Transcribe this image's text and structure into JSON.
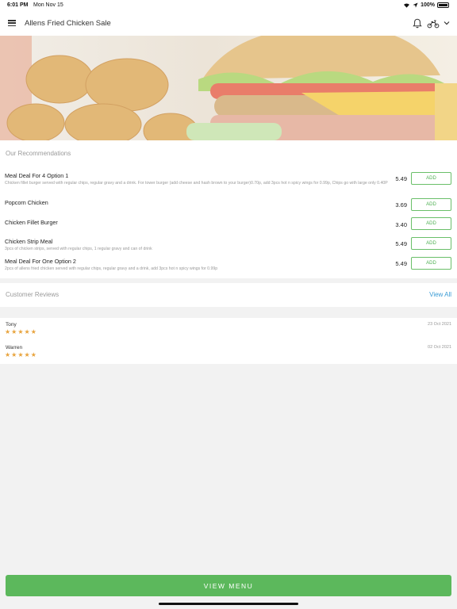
{
  "status": {
    "time": "6:01 PM",
    "date": "Mon Nov 15",
    "battery": "100%"
  },
  "header": {
    "title": "Allens Fried Chicken Sale"
  },
  "recommendations": {
    "title": "Our Recommendations",
    "add_label": "ADD",
    "items": [
      {
        "name": "Meal Deal For 4 Option 1",
        "desc": "Chicken fillet burger served with regular chips, regular gravy and a drink. For tower burger (add cheese and hash brown to your burger)0.70p, add 3pcs hot n spicy wings for 0.99p, Chips go with large only 0.40P",
        "price": "5.49"
      },
      {
        "name": "Popcorn Chicken",
        "desc": "",
        "price": "3.69"
      },
      {
        "name": "Chicken Fillet Burger",
        "desc": "",
        "price": "3.40"
      },
      {
        "name": "Chicken Strip Meal",
        "desc": "3pcs of chicken strips, served with regular chips, 1 regular gravy and can of drink",
        "price": "5.49"
      },
      {
        "name": "Meal Deal For One Option 2",
        "desc": "2pcs of allens fried chicken served with regular chips, regular gravy and a drink, add 3pcs hot n spicy wings for 0.99p",
        "price": "5.49"
      }
    ]
  },
  "reviews": {
    "title": "Customer Reviews",
    "view_all": "View All",
    "items": [
      {
        "name": "Tony",
        "date": "23 Oct 2021",
        "rating": 5
      },
      {
        "name": "Warren",
        "date": "02 Oct 2021",
        "rating": 5
      }
    ]
  },
  "footer": {
    "view_menu": "VIEW MENU"
  },
  "colors": {
    "accent": "#5cb85c",
    "link": "#3a9bd5",
    "star": "#e8a33c"
  }
}
